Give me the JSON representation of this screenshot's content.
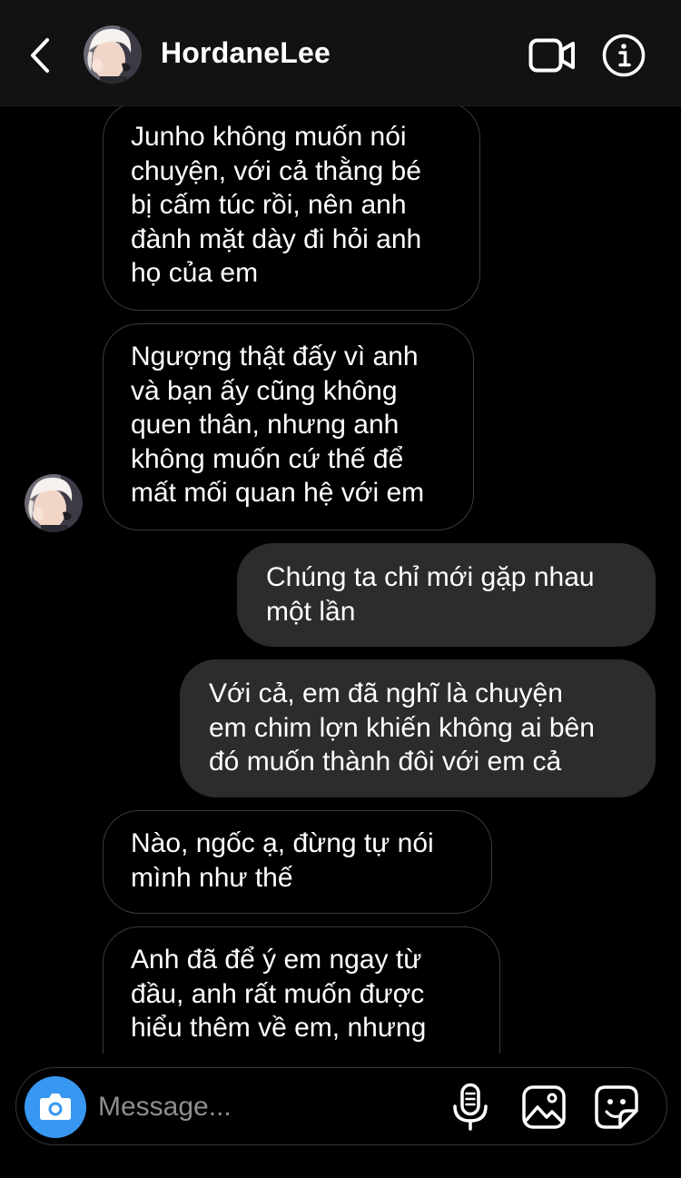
{
  "header": {
    "username": "HordaneLee"
  },
  "messages": [
    {
      "from": "them",
      "text": "Junho không muốn nói\nchuyện, với cả thằng bé\nbị cấm túc rồi, nên anh\nđành mặt dày đi hỏi anh\nhọ của em"
    },
    {
      "from": "them",
      "text": "Ngượng thật đấy vì anh\nvà bạn ấy cũng không\nquen thân, nhưng anh\nkhông muốn cứ thế để\nmất mối quan hệ với em"
    },
    {
      "from": "me",
      "text": "Chúng ta chỉ mới gặp nhau\nmột lần"
    },
    {
      "from": "me",
      "text": "Với cả, em đã nghĩ là chuyện\nem chim lợn khiến không ai bên\nđó muốn thành đôi với em cả"
    },
    {
      "from": "them",
      "text": "Nào, ngốc ạ, đừng tự nói\nmình như thế"
    },
    {
      "from": "them",
      "text": "Anh đã để ý em ngay từ\nđầu, anh rất muốn được\nhiểu thêm về em, nhưng\n"
    }
  ],
  "composer": {
    "placeholder": "Message..."
  },
  "icons": {
    "back": "chevron-left-icon",
    "video": "video-camera-icon",
    "info": "info-icon",
    "camera": "camera-icon",
    "mic": "microphone-icon",
    "gallery": "image-icon",
    "sticker": "sticker-icon"
  },
  "colors": {
    "background": "#000000",
    "header": "#121212",
    "outgoing_bubble": "#2c2c2e",
    "incoming_border": "#3b3b3b",
    "camera_button": "#3897f0",
    "placeholder": "#8e8e8e"
  }
}
